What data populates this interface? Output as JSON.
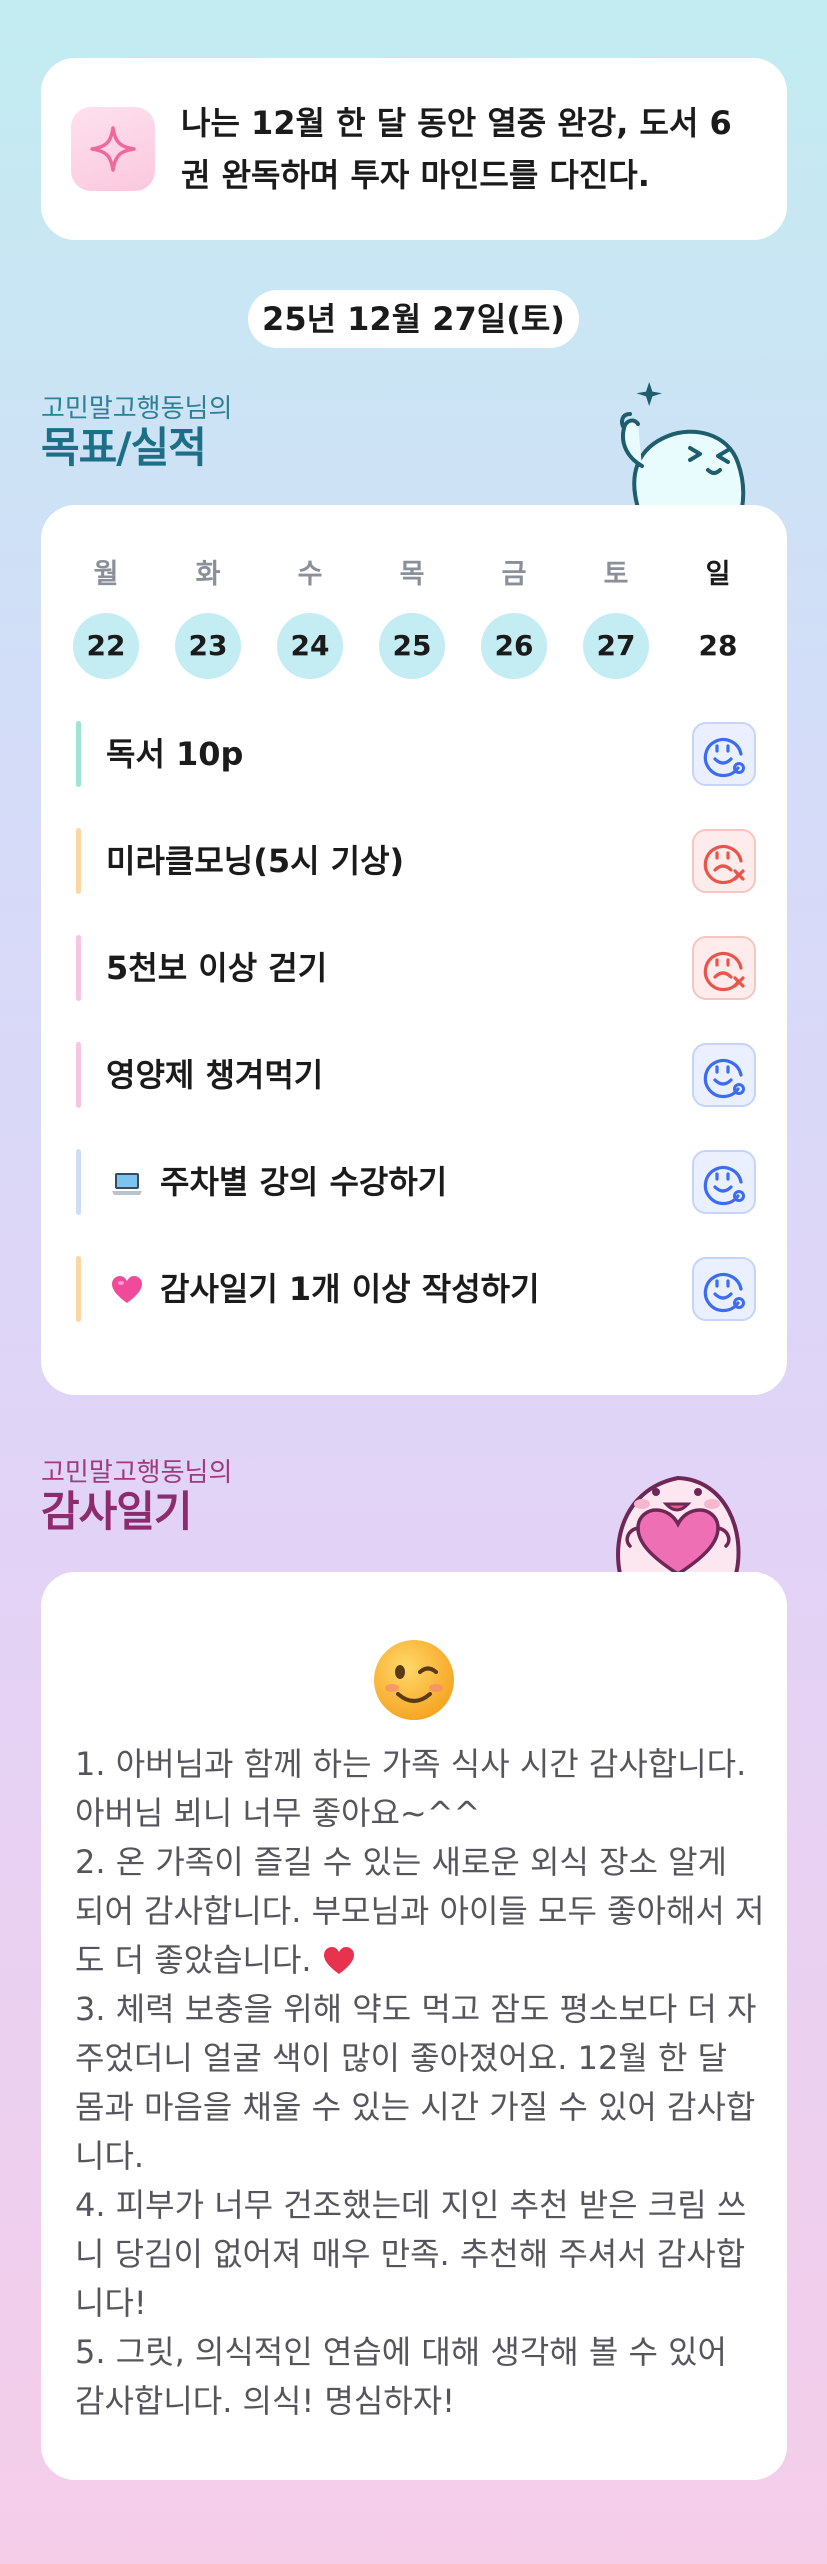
{
  "goal": {
    "text": "나는 12월 한 달 동안 열중 완강, 도서 6권 완독하며 투자 마인드를 다진다."
  },
  "date_label": "25년 12월 27일(토)",
  "goals_section": {
    "subtitle": "고민말고행동님의",
    "title": "목표/실적"
  },
  "week": [
    {
      "name": "월",
      "num": "22",
      "marked": true
    },
    {
      "name": "화",
      "num": "23",
      "marked": true
    },
    {
      "name": "수",
      "num": "24",
      "marked": true
    },
    {
      "name": "목",
      "num": "25",
      "marked": true
    },
    {
      "name": "금",
      "num": "26",
      "marked": true
    },
    {
      "name": "토",
      "num": "27",
      "marked": true
    },
    {
      "name": "일",
      "num": "28",
      "marked": false
    }
  ],
  "tasks": [
    {
      "label": "독서 10p",
      "status": "done",
      "bar_color": "#9fe3d2",
      "emoji": ""
    },
    {
      "label": "미라클모닝(5시 기상)",
      "status": "fail",
      "bar_color": "#fbd7a4",
      "emoji": ""
    },
    {
      "label": "5천보 이상 걷기",
      "status": "fail",
      "bar_color": "#f6c6e2",
      "emoji": ""
    },
    {
      "label": "영양제 챙겨먹기",
      "status": "done",
      "bar_color": "#f6c6e2",
      "emoji": ""
    },
    {
      "label": "주차별 강의 수강하기",
      "status": "done",
      "bar_color": "#cfdcf7",
      "emoji": "laptop"
    },
    {
      "label": "감사일기 1개 이상 작성하기",
      "status": "done",
      "bar_color": "#fbd7a4",
      "emoji": "heart"
    }
  ],
  "gratitude_section": {
    "subtitle": "고민말고행동님의",
    "title": "감사일기"
  },
  "gratitude": {
    "emoji": "winking-face",
    "lines": [
      "1. 아버님과 함께 하는 가족 식사 시간 감사합니다. 아버님 뵈니 너무 좋아요~^^",
      "2. 온 가족이 즐길 수 있는 새로운 외식 장소 알게 되어 감사합니다. 부모님과 아이들 모두 좋아해서 저도 더 좋았습니다.",
      "3. 체력 보충을 위해 약도 먹고 잠도 평소보다 더 자주었더니 얼굴 색이 많이 좋아졌어요. 12월 한 달 몸과 마음을 채울 수 있는 시간 가질 수 있어 감사합니다.",
      "4. 피부가 너무 건조했는데 지인 추천 받은 크림 쓰니 당김이 없어져 매우 만족. 추천해 주셔서 감사합니다!",
      "5. 그릿, 의식적인 연습에 대해 생각해 볼 수 있어 감사합니다. 의식! 명심하자!"
    ]
  },
  "colors": {
    "good": "#3d6cf0",
    "bad": "#e9554a",
    "day_circle": "#c4ecf3"
  }
}
